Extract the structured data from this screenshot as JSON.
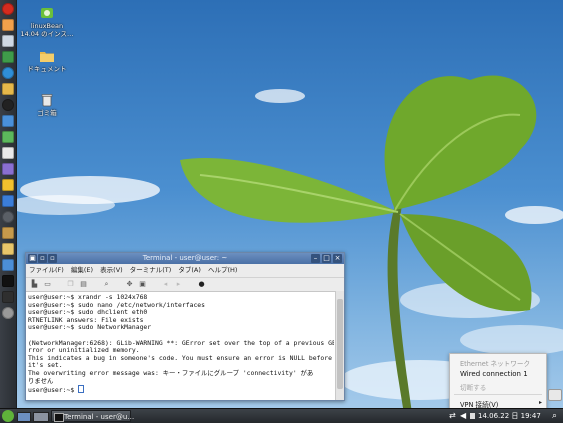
{
  "desktop": {
    "icons": [
      {
        "name": "linuxbean-icon",
        "label_line1": "linuxBean",
        "label_line2": "14.04 のインス…"
      },
      {
        "name": "documents-folder-icon",
        "label_line1": "ドキュメント"
      },
      {
        "name": "trash-icon",
        "label_line1": "ゴミ箱"
      }
    ]
  },
  "terminal": {
    "title": "Terminal - user@user: ~",
    "menu": [
      "ファイル(F)",
      "編集(E)",
      "表示(V)",
      "ターミナル(T)",
      "タブ(A)",
      "ヘルプ(H)"
    ],
    "lines": [
      "user@user:~$ xrandr -s 1024x768",
      "user@user:~$ sudo nano /etc/network/interfaces",
      "user@user:~$ sudo dhclient eth0",
      "RTNETLINK answers: File exists",
      "user@user:~$ sudo NetworkManager",
      "",
      "(NetworkManager:6268): GLib-WARNING **: GError set over the top of a previous GE",
      "rror or uninitialized memory.",
      "This indicates a bug in someone's code. You must ensure an error is NULL before",
      "it's set.",
      "The overwriting error message was: キー・ファイルにグループ 'connectivity' があ",
      "りません"
    ],
    "prompt": "user@user:~$ "
  },
  "network_menu": {
    "header": "Ethernet ネットワーク",
    "connection": "Wired connection 1",
    "disconnect": "切断する",
    "vpn": "VPN 接続(V)"
  },
  "taskbar": {
    "task_label": "Terminal - user@u…",
    "clock": "14.06.22 日 19:47"
  }
}
